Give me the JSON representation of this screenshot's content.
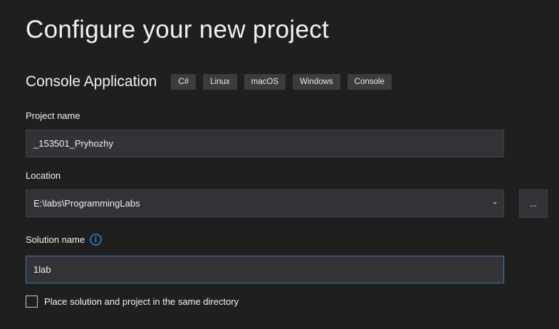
{
  "page": {
    "title": "Configure your new project"
  },
  "template": {
    "name": "Console Application",
    "tags": [
      "C#",
      "Linux",
      "macOS",
      "Windows",
      "Console"
    ]
  },
  "project_name": {
    "label": "Project name",
    "value": "_153501_Pryhozhy"
  },
  "location": {
    "label": "Location",
    "value": "E:\\labs\\ProgrammingLabs",
    "browse_label": "..."
  },
  "solution_name": {
    "label": "Solution name",
    "value": "1lab",
    "info_icon": "info-circle-icon"
  },
  "same_directory": {
    "label": "Place solution and project in the same directory",
    "checked": false
  },
  "colors": {
    "background": "#1f1f1f",
    "field_background": "#333337",
    "tag_background": "#3c3c3c",
    "focus_border": "#3f78b3",
    "info_accent": "#3794ff"
  }
}
